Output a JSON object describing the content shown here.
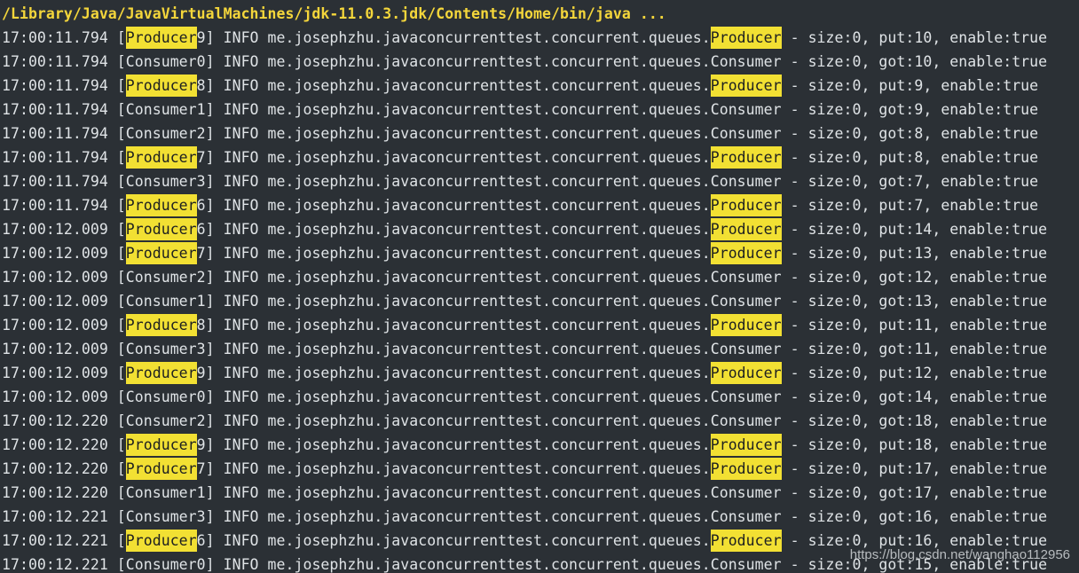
{
  "console": {
    "command": "/Library/Java/JavaVirtualMachines/jdk-11.0.3.jdk/Contents/Home/bin/java ...",
    "highlight_term": "Producer",
    "highlight_color": "#f2e033",
    "log_lines": [
      {
        "time": "17:00:11.794",
        "thread_name": "Producer",
        "thread_num": "9",
        "level": "INFO",
        "logger_prefix": "me.josephzhu.javaconcurrenttest.concurrent.queues.",
        "logger_class": "Producer",
        "message": "size:0, put:10, enable:true"
      },
      {
        "time": "17:00:11.794",
        "thread_name": "Consumer",
        "thread_num": "0",
        "level": "INFO",
        "logger_prefix": "me.josephzhu.javaconcurrenttest.concurrent.queues.",
        "logger_class": "Consumer",
        "message": "size:0, got:10, enable:true"
      },
      {
        "time": "17:00:11.794",
        "thread_name": "Producer",
        "thread_num": "8",
        "level": "INFO",
        "logger_prefix": "me.josephzhu.javaconcurrenttest.concurrent.queues.",
        "logger_class": "Producer",
        "message": "size:0, put:9, enable:true"
      },
      {
        "time": "17:00:11.794",
        "thread_name": "Consumer",
        "thread_num": "1",
        "level": "INFO",
        "logger_prefix": "me.josephzhu.javaconcurrenttest.concurrent.queues.",
        "logger_class": "Consumer",
        "message": "size:0, got:9, enable:true"
      },
      {
        "time": "17:00:11.794",
        "thread_name": "Consumer",
        "thread_num": "2",
        "level": "INFO",
        "logger_prefix": "me.josephzhu.javaconcurrenttest.concurrent.queues.",
        "logger_class": "Consumer",
        "message": "size:0, got:8, enable:true"
      },
      {
        "time": "17:00:11.794",
        "thread_name": "Producer",
        "thread_num": "7",
        "level": "INFO",
        "logger_prefix": "me.josephzhu.javaconcurrenttest.concurrent.queues.",
        "logger_class": "Producer",
        "message": "size:0, put:8, enable:true"
      },
      {
        "time": "17:00:11.794",
        "thread_name": "Consumer",
        "thread_num": "3",
        "level": "INFO",
        "logger_prefix": "me.josephzhu.javaconcurrenttest.concurrent.queues.",
        "logger_class": "Consumer",
        "message": "size:0, got:7, enable:true"
      },
      {
        "time": "17:00:11.794",
        "thread_name": "Producer",
        "thread_num": "6",
        "level": "INFO",
        "logger_prefix": "me.josephzhu.javaconcurrenttest.concurrent.queues.",
        "logger_class": "Producer",
        "message": "size:0, put:7, enable:true"
      },
      {
        "time": "17:00:12.009",
        "thread_name": "Producer",
        "thread_num": "6",
        "level": "INFO",
        "logger_prefix": "me.josephzhu.javaconcurrenttest.concurrent.queues.",
        "logger_class": "Producer",
        "message": "size:0, put:14, enable:true"
      },
      {
        "time": "17:00:12.009",
        "thread_name": "Producer",
        "thread_num": "7",
        "level": "INFO",
        "logger_prefix": "me.josephzhu.javaconcurrenttest.concurrent.queues.",
        "logger_class": "Producer",
        "message": "size:0, put:13, enable:true"
      },
      {
        "time": "17:00:12.009",
        "thread_name": "Consumer",
        "thread_num": "2",
        "level": "INFO",
        "logger_prefix": "me.josephzhu.javaconcurrenttest.concurrent.queues.",
        "logger_class": "Consumer",
        "message": "size:0, got:12, enable:true"
      },
      {
        "time": "17:00:12.009",
        "thread_name": "Consumer",
        "thread_num": "1",
        "level": "INFO",
        "logger_prefix": "me.josephzhu.javaconcurrenttest.concurrent.queues.",
        "logger_class": "Consumer",
        "message": "size:0, got:13, enable:true"
      },
      {
        "time": "17:00:12.009",
        "thread_name": "Producer",
        "thread_num": "8",
        "level": "INFO",
        "logger_prefix": "me.josephzhu.javaconcurrenttest.concurrent.queues.",
        "logger_class": "Producer",
        "message": "size:0, put:11, enable:true"
      },
      {
        "time": "17:00:12.009",
        "thread_name": "Consumer",
        "thread_num": "3",
        "level": "INFO",
        "logger_prefix": "me.josephzhu.javaconcurrenttest.concurrent.queues.",
        "logger_class": "Consumer",
        "message": "size:0, got:11, enable:true"
      },
      {
        "time": "17:00:12.009",
        "thread_name": "Producer",
        "thread_num": "9",
        "level": "INFO",
        "logger_prefix": "me.josephzhu.javaconcurrenttest.concurrent.queues.",
        "logger_class": "Producer",
        "message": "size:0, put:12, enable:true"
      },
      {
        "time": "17:00:12.009",
        "thread_name": "Consumer",
        "thread_num": "0",
        "level": "INFO",
        "logger_prefix": "me.josephzhu.javaconcurrenttest.concurrent.queues.",
        "logger_class": "Consumer",
        "message": "size:0, got:14, enable:true"
      },
      {
        "time": "17:00:12.220",
        "thread_name": "Consumer",
        "thread_num": "2",
        "level": "INFO",
        "logger_prefix": "me.josephzhu.javaconcurrenttest.concurrent.queues.",
        "logger_class": "Consumer",
        "message": "size:0, got:18, enable:true"
      },
      {
        "time": "17:00:12.220",
        "thread_name": "Producer",
        "thread_num": "9",
        "level": "INFO",
        "logger_prefix": "me.josephzhu.javaconcurrenttest.concurrent.queues.",
        "logger_class": "Producer",
        "message": "size:0, put:18, enable:true"
      },
      {
        "time": "17:00:12.220",
        "thread_name": "Producer",
        "thread_num": "7",
        "level": "INFO",
        "logger_prefix": "me.josephzhu.javaconcurrenttest.concurrent.queues.",
        "logger_class": "Producer",
        "message": "size:0, put:17, enable:true"
      },
      {
        "time": "17:00:12.220",
        "thread_name": "Consumer",
        "thread_num": "1",
        "level": "INFO",
        "logger_prefix": "me.josephzhu.javaconcurrenttest.concurrent.queues.",
        "logger_class": "Consumer",
        "message": "size:0, got:17, enable:true"
      },
      {
        "time": "17:00:12.221",
        "thread_name": "Consumer",
        "thread_num": "3",
        "level": "INFO",
        "logger_prefix": "me.josephzhu.javaconcurrenttest.concurrent.queues.",
        "logger_class": "Consumer",
        "message": "size:0, got:16, enable:true"
      },
      {
        "time": "17:00:12.221",
        "thread_name": "Producer",
        "thread_num": "6",
        "level": "INFO",
        "logger_prefix": "me.josephzhu.javaconcurrenttest.concurrent.queues.",
        "logger_class": "Producer",
        "message": "size:0, put:16, enable:true"
      },
      {
        "time": "17:00:12.221",
        "thread_name": "Consumer",
        "thread_num": "0",
        "level": "INFO",
        "logger_prefix": "me.josephzhu.javaconcurrenttest.concurrent.queues.",
        "logger_class": "Consumer",
        "message": "size:0, got:15, enable:true"
      }
    ]
  },
  "watermark": "https://blog.csdn.net/wanghao112956"
}
